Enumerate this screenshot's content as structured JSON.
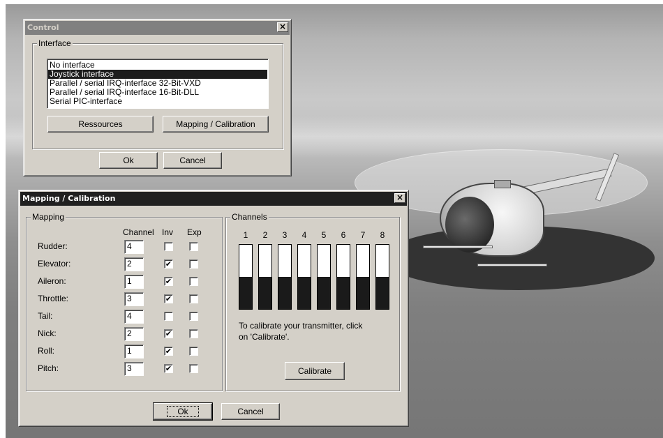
{
  "control_dialog": {
    "title": "Control",
    "interface_group_label": "Interface",
    "interface_options": [
      "No interface",
      "Joystick interface",
      "Parallel / serial IRQ-interface 32-Bit-VXD",
      "Parallel / serial IRQ-interface 16-Bit-DLL",
      "Serial PIC-interface"
    ],
    "selected_index": 1,
    "resources_button": "Ressources",
    "mapping_button": "Mapping / Calibration",
    "ok_button": "Ok",
    "cancel_button": "Cancel"
  },
  "mapping_dialog": {
    "title": "Mapping / Calibration",
    "mapping_group_label": "Mapping",
    "columns": {
      "channel": "Channel",
      "inv": "Inv",
      "exp": "Exp"
    },
    "rows": [
      {
        "label": "Rudder:",
        "channel": "4",
        "inv": false,
        "exp": false
      },
      {
        "label": "Elevator:",
        "channel": "2",
        "inv": true,
        "exp": false
      },
      {
        "label": "Aileron:",
        "channel": "1",
        "inv": true,
        "exp": false
      },
      {
        "label": "Throttle:",
        "channel": "3",
        "inv": true,
        "exp": false
      },
      {
        "label": "Tail:",
        "channel": "4",
        "inv": false,
        "exp": false
      },
      {
        "label": "Nick:",
        "channel": "2",
        "inv": true,
        "exp": false
      },
      {
        "label": "Roll:",
        "channel": "1",
        "inv": true,
        "exp": false
      },
      {
        "label": "Pitch:",
        "channel": "3",
        "inv": true,
        "exp": false
      }
    ],
    "channels_group_label": "Channels",
    "channels": [
      {
        "label": "1",
        "level": 0.5
      },
      {
        "label": "2",
        "level": 0.5
      },
      {
        "label": "3",
        "level": 0.5
      },
      {
        "label": "4",
        "level": 0.5
      },
      {
        "label": "5",
        "level": 0.5
      },
      {
        "label": "6",
        "level": 0.5
      },
      {
        "label": "7",
        "level": 0.5
      },
      {
        "label": "8",
        "level": 0.5
      }
    ],
    "calibrate_note_line1": "To calibrate your transmitter, click",
    "calibrate_note_line2": "on 'Calibrate'.",
    "calibrate_button": "Calibrate",
    "ok_button": "Ok",
    "cancel_button": "Cancel"
  },
  "close_symbol": "×",
  "check_symbol": "✔",
  "colors": {
    "dialog_face": "#d4d0c8",
    "active_title": "#202020",
    "inactive_title": "#808080",
    "selection": "#1c1c1c"
  }
}
